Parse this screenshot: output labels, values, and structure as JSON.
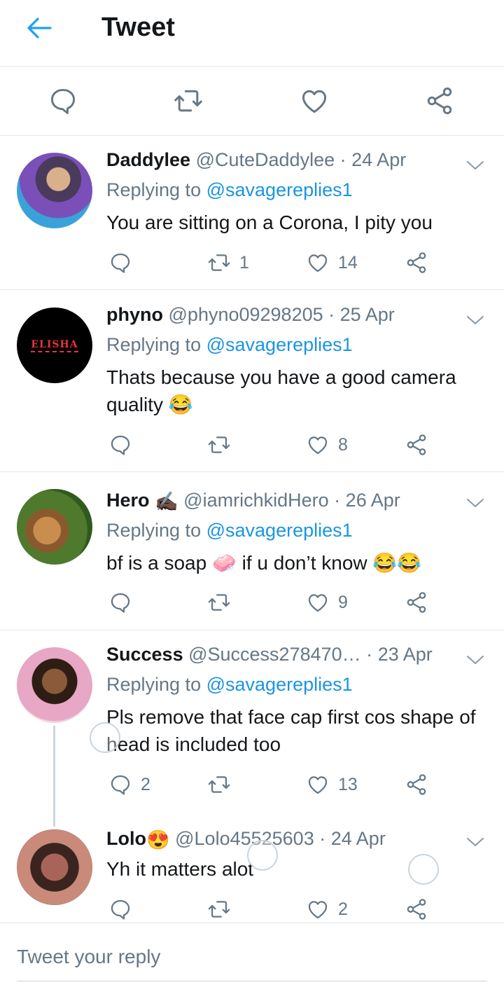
{
  "header": {
    "title": "Tweet",
    "back_icon": "arrow-left-icon"
  },
  "colors": {
    "accent": "#1da1f2",
    "mention": "#1b95e0",
    "muted": "#657786",
    "text": "#14171a",
    "divider": "#e1e8ed"
  },
  "action_bar": {
    "icons": [
      "reply-icon",
      "retweet-icon",
      "like-icon",
      "share-icon"
    ]
  },
  "replies": [
    {
      "name": "Daddylee",
      "handle": "@CuteDaddylee",
      "separator": "·",
      "date": "24 Apr",
      "replying_prefix": "Replying to",
      "replying_to": "@savagereplies1",
      "text": "You are sitting on a Corona, I pity you",
      "reply_count": "",
      "retweet_count": "1",
      "like_count": "14"
    },
    {
      "name": "phyno",
      "handle": "@phyno09298205",
      "separator": "·",
      "date": "25 Apr",
      "replying_prefix": "Replying to",
      "replying_to": "@savagereplies1",
      "text": "Thats because you have a good camera quality 😂",
      "avatar_text": "ELISHA",
      "reply_count": "",
      "retweet_count": "",
      "like_count": "8"
    },
    {
      "name": "Hero",
      "name_emoji": "✍🏿",
      "handle": "@iamrichkidHero",
      "separator": "·",
      "date": "26 Apr",
      "replying_prefix": "Replying to",
      "replying_to": "@savagereplies1",
      "text": "bf is a soap 🧼 if u don’t know 😂😂",
      "reply_count": "",
      "retweet_count": "",
      "like_count": "9"
    },
    {
      "name": "Success",
      "handle": "@Success278470…",
      "separator": "·",
      "date": "23 Apr",
      "replying_prefix": "Replying to",
      "replying_to": "@savagereplies1",
      "text": "Pls remove that face cap first cos shape of head is included too",
      "reply_count": "2",
      "retweet_count": "",
      "like_count": "13"
    },
    {
      "name": "Lolo",
      "name_emoji": "😍",
      "handle": "@Lolo45525603",
      "separator": "·",
      "date": "24 Apr",
      "text": "Yh it matters alot",
      "reply_count": "",
      "retweet_count": "",
      "like_count": "2"
    }
  ],
  "composer": {
    "placeholder": "Tweet your reply"
  }
}
